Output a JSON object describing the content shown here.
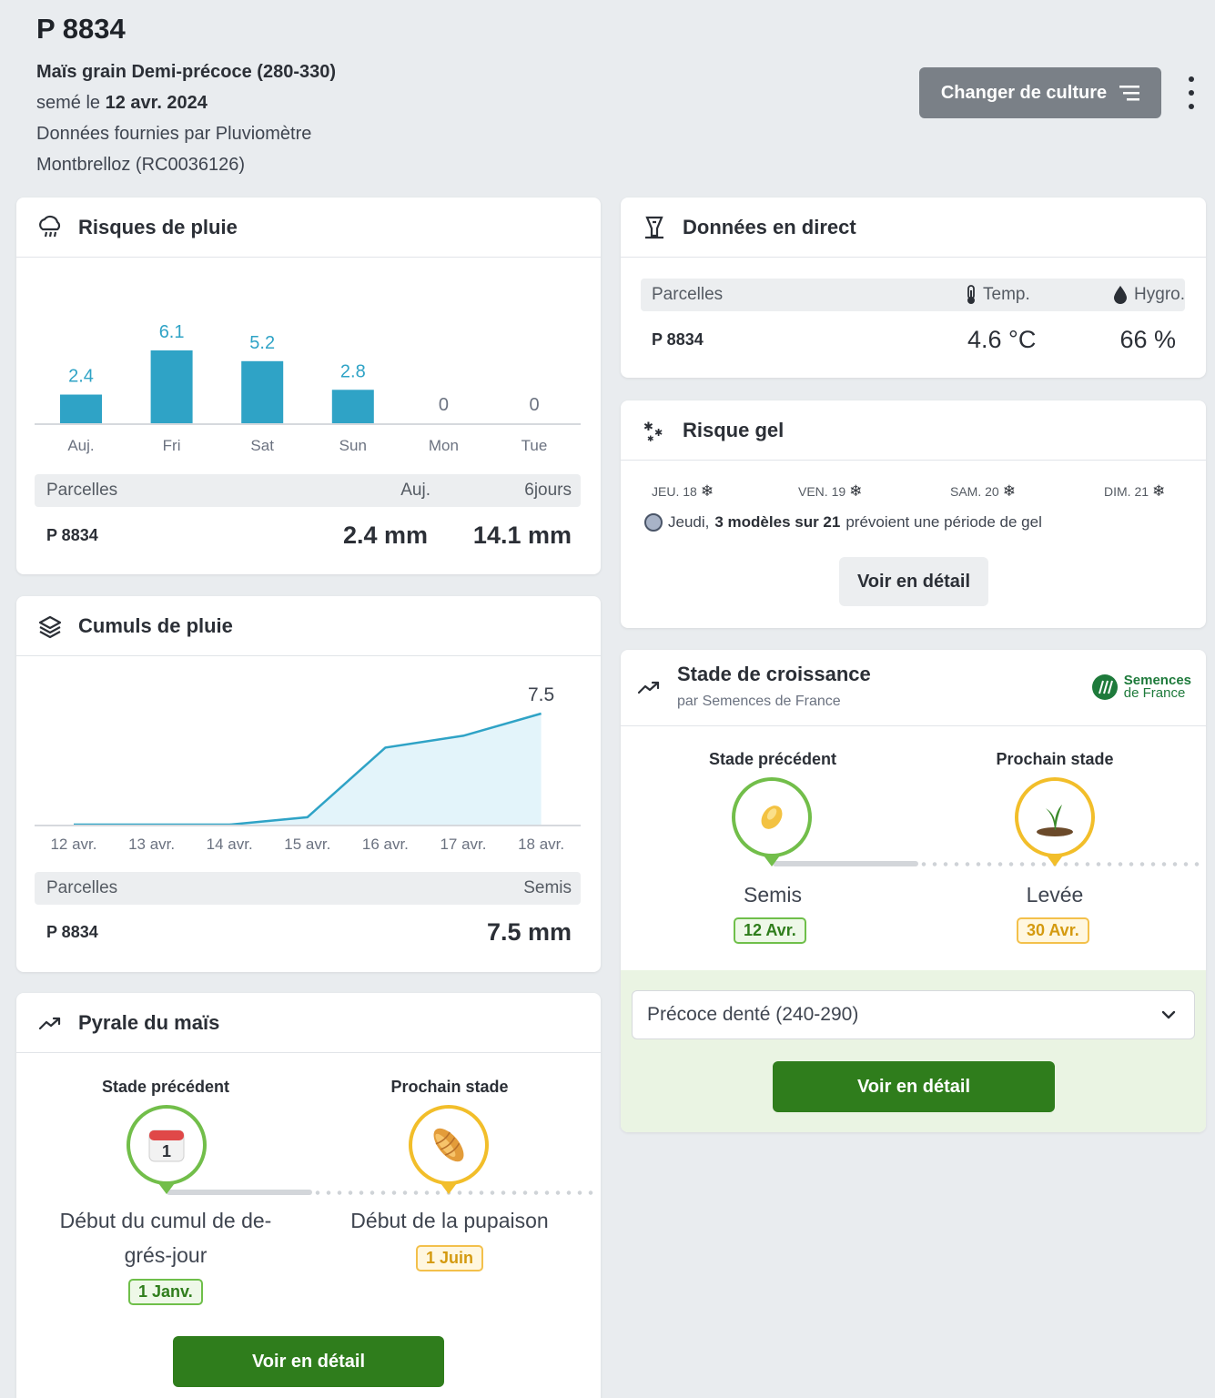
{
  "header": {
    "title": "P 8834",
    "crop": "Maïs grain Demi-précoce (280-330)",
    "sown_prefix": "semé le",
    "sown_date": "12 avr. 2024",
    "source_line": "Données fournies par Pluviomètre",
    "station": "Montbrelloz (RC0036126)",
    "change_button": "Changer de culture"
  },
  "rain_risk": {
    "title": "Risques de pluie",
    "chart_data": {
      "type": "bar",
      "categories": [
        "Auj.",
        "Fri",
        "Sat",
        "Sun",
        "Mon",
        "Tue"
      ],
      "values": [
        2.4,
        6.1,
        5.2,
        2.8,
        0,
        0
      ],
      "value_labels": [
        "2.4",
        "6.1",
        "5.2",
        "2.8",
        "0",
        "0"
      ]
    },
    "table": {
      "col_name": "Parcelles",
      "col_today": "Auj.",
      "col_6days": "6jours",
      "row_name": "P 8834",
      "row_today": "2.4 mm",
      "row_6days": "14.1 mm"
    }
  },
  "rain_cumul": {
    "title": "Cumuls de pluie",
    "chart_data": {
      "type": "area",
      "x": [
        "12 avr.",
        "13 avr.",
        "14 avr.",
        "15 avr.",
        "16 avr.",
        "17 avr.",
        "18 avr."
      ],
      "y": [
        0,
        0,
        0,
        0.5,
        5.2,
        6.0,
        7.5
      ],
      "end_label": "7.5"
    },
    "table": {
      "col_name": "Parcelles",
      "col_value": "Semis",
      "row_name": "P 8834",
      "row_value": "7.5 mm"
    }
  },
  "pyrale": {
    "title": "Pyrale du maïs",
    "prev_label": "Stade précédent",
    "next_label": "Prochain stade",
    "prev_name": "Début du cumul de de-grés-jour",
    "prev_date": "1 Janv.",
    "next_name": "Début de la pupaison",
    "next_date": "1 Juin",
    "calendar_number": "1",
    "detail_button": "Voir en détail"
  },
  "live": {
    "title": "Données en direct",
    "col_name": "Parcelles",
    "col_temp": "Temp.",
    "col_hygro": "Hygro.",
    "row_name": "P 8834",
    "row_temp": "4.6 °C",
    "row_hygro": "66 %"
  },
  "frost": {
    "title": "Risque gel",
    "days": [
      "JEU. 18",
      "VEN. 19",
      "SAM. 20",
      "DIM. 21"
    ],
    "note_prefix": "Jeudi,",
    "note_bold": "3 modèles sur 21",
    "note_suffix": "prévoient une période de gel",
    "detail_button": "Voir en détail"
  },
  "growth": {
    "title": "Stade de croissance",
    "subtitle": "par Semences de France",
    "brand_line1": "Semences",
    "brand_line2": "de France",
    "prev_label": "Stade précédent",
    "next_label": "Prochain stade",
    "prev_name": "Semis",
    "prev_date": "12 Avr.",
    "next_name": "Levée",
    "next_date": "30 Avr.",
    "variety": "Précoce denté (240-290)",
    "detail_button": "Voir en détail"
  },
  "colors": {
    "bar": "#2fa3c6",
    "area_fill": "#e3f4fa",
    "green": "#2f7d1c",
    "light_green_bg": "#eaf4e3"
  }
}
